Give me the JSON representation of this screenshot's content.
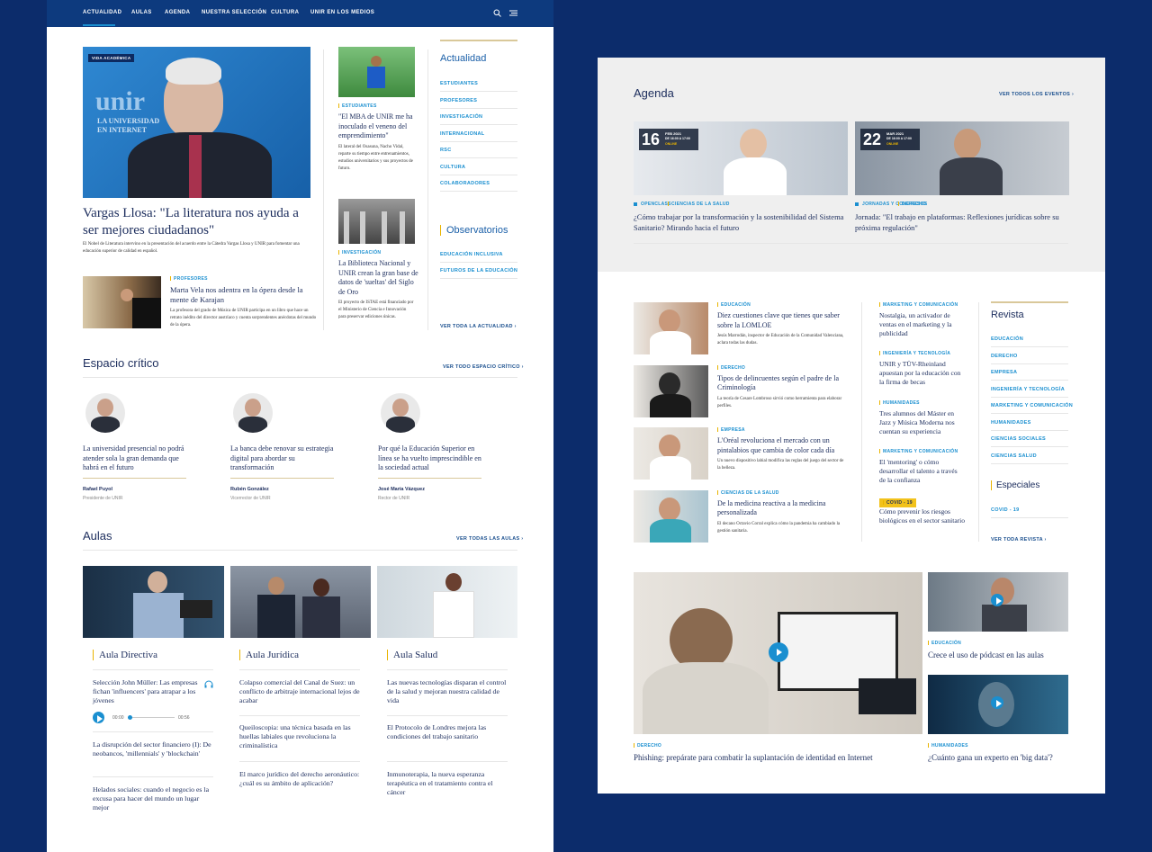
{
  "nav": {
    "items": [
      "ACTUALIDAD",
      "AULAS",
      "AGENDA",
      "NUESTRA SELECCIÓN",
      "CULTURA",
      "UNIR EN LOS MEDIOS"
    ]
  },
  "hero": {
    "badge": "VIDA ACADÉMICA",
    "img_text1": "unir",
    "img_text2": "LA UNIVERSIDAD",
    "img_text3": "EN INTERNET",
    "title": "Vargas Llosa: \"La literatura nos ayuda a ser mejores ciudadanos\"",
    "summary": "El Nobel de Literatura intervino en la presentación del acuerdo entre la Cátedra Vargas Llosa y UNIR para fomentar una educación superior de calidad en español."
  },
  "small_story": {
    "kicker": "PROFESORES",
    "title": "Marta Vela nos adentra en la ópera desde la mente de Karajan",
    "summary": "La profesora del grado de Música de UNIR participa en un libro que hace un retrato inédito del director austríaco y cuenta sorprendentes anécdotas del mundo de la ópera."
  },
  "mid_stories": [
    {
      "kicker": "ESTUDIANTES",
      "title": "\"El MBA de UNIR me ha inoculado el veneno del emprendimiento\"",
      "summary": "El lateral del Osasuna, Nacho Vidal, reparte su tiempo entre entrenamientos, estudios universitarios y sus proyectos de futuro."
    },
    {
      "kicker": "INVESTIGACIÓN",
      "title": "La Biblioteca Nacional y UNIR crean la gran base de datos de 'sueltas' del Siglo de Oro",
      "summary": "El proyecto de ISTAE está financiado por el Ministerio de Ciencia e Innovación para preservar ediciones únicas."
    }
  ],
  "actualidad": {
    "title": "Actualidad",
    "items": [
      "ESTUDIANTES",
      "PROFESORES",
      "INVESTIGACIÓN",
      "INTERNACIONAL",
      "RSC",
      "CULTURA",
      "COLABORADORES"
    ],
    "obs_title": "Observatorios",
    "obs_items": [
      "EDUCACIÓN INCLUSIVA",
      "FUTUROS DE LA EDUCACIÓN"
    ],
    "more": "VER TODA LA ACTUALIDAD ›"
  },
  "espacio": {
    "title": "Espacio crítico",
    "more": "VER TODO ESPACIO CRÍTICO ›",
    "items": [
      {
        "quote": "La universidad presencial no podrá atender sola la gran demanda que habrá en el futuro",
        "name": "Rafael Puyol",
        "role": "Presidente de UNIR"
      },
      {
        "quote": "La banca debe renovar su estrategia digital para abordar su transformación",
        "name": "Rubén González",
        "role": "Vicerrector de UNIR"
      },
      {
        "quote": "Por qué la Educación Superior en línea se ha vuelto imprescindible en la sociedad actual",
        "name": "José María Vázquez",
        "role": "Rector de UNIR"
      }
    ]
  },
  "aulas": {
    "title": "Aulas",
    "more": "VER TODAS LAS AULAS ›",
    "cols": [
      {
        "title": "Aula Directiva",
        "items": [
          "Selección John Müller: Las empresas fichan 'influencers' para atrapar a los jóvenes",
          "La disrupción del sector financiero (I): De neobancos, 'millennials' y 'blockchain'",
          "Helados sociales: cuando el negocio es la excusa para hacer del mundo un lugar mejor"
        ],
        "audio_start": "00:00",
        "audio_end": "00:56"
      },
      {
        "title": "Aula Jurídica",
        "items": [
          "Colapso comercial del Canal de Suez: un conflicto de arbitraje internacional lejos de acabar",
          "Queiloscopia: una técnica basada en las huellas labiales que revoluciona la criminalística",
          "El marco jurídico del derecho aeronáutico: ¿cuál es su ámbito de aplicación?"
        ]
      },
      {
        "title": "Aula Salud",
        "items": [
          "Las nuevas tecnologías disparan el control de la salud y mejoran nuestra calidad de vida",
          "El Protocolo de Londres mejora las condiciones del trabajo sanitario",
          "Inmunoterapia, la nueva esperanza terapéutica en el tratamiento contra el cáncer"
        ]
      }
    ]
  },
  "agenda": {
    "title": "Agenda",
    "more": "VER TODOS LOS EVENTOS ›",
    "events": [
      {
        "day": "16",
        "month": "FEB 2021",
        "time": "DE 16:00 A 17:00",
        "mode": "ONLINE",
        "tag1": "OPENCLASS",
        "tag2": "CIENCIAS DE LA SALUD",
        "title": "¿Cómo trabajar por la transformación y la sostenibilidad del Sistema Sanitario? Mirando hacia el futuro"
      },
      {
        "day": "22",
        "month": "MAR 2021",
        "time": "DE 16:00 A 17:00",
        "mode": "ONLINE",
        "tag1": "JORNADAS Y CONGRESOS",
        "tag2": "DERECHO",
        "title": "Jornada: \"El trabajo en plataformas: Reflexiones jurídicas sobre su próxima regulación\""
      }
    ]
  },
  "list_stories": [
    {
      "kicker": "EDUCACIÓN",
      "title": "Diez cuestiones clave que tienes que saber sobre la LOMLOE",
      "summary": "Jesús Marrodán, inspector de Educación de la Comunidad Valenciana, aclara todas las dudas."
    },
    {
      "kicker": "DERECHO",
      "title": "Tipos de delincuentes según el padre de la Criminología",
      "summary": "La teoría de Cesare Lombroso sirvió como herramienta para elaborar perfiles."
    },
    {
      "kicker": "EMPRESA",
      "title": "L'Oréal revoluciona el mercado con un pintalabios que cambia de color cada día",
      "summary": "Un nuevo dispositivo labial modifica las reglas del juego del sector de la belleza."
    },
    {
      "kicker": "CIENCIAS DE LA SALUD",
      "title": "De la medicina reactiva a la medicina personalizada",
      "summary": "El decano Octavio Corral explica cómo la pandemia ha cambiado la gestión sanitaria."
    }
  ],
  "side_stories": [
    {
      "kicker": "MARKETING Y COMUNICACIÓN",
      "title": "Nostalgia, un activador de ventas en el marketing y la publicidad"
    },
    {
      "kicker": "INGENIERÍA Y TECNOLOGÍA",
      "title": "UNIR y TÜV-Rheinland apuestan por la educación con la firma de becas"
    },
    {
      "kicker": "HUMANIDADES",
      "title": "Tres alumnos del Máster en Jazz y Música Moderna nos cuentan su experiencia"
    },
    {
      "kicker": "MARKETING Y COMUNICACIÓN",
      "title": "El 'mentoring' o cómo desarrollar el talento a través de la confianza"
    },
    {
      "kicker": "COVID - 19",
      "title": "Cómo prevenir los riesgos biológicos en el sector sanitario"
    }
  ],
  "revista": {
    "title": "Revista",
    "items": [
      "EDUCACIÓN",
      "DERECHO",
      "EMPRESA",
      "INGENIERÍA Y TECNOLOGÍA",
      "MARKETING Y COMUNICACIÓN",
      "HUMANIDADES",
      "CIENCIAS SOCIALES",
      "CIENCIAS SALUD"
    ],
    "esp_title": "Especiales",
    "esp_items": [
      "COVID - 19"
    ],
    "more": "VER TODA REVISTA ›"
  },
  "media": {
    "main_kicker": "DERECHO",
    "main_title": "Phishing: prepárate para combatir la suplantación de identidad en Internet",
    "s1_kicker": "EDUCACIÓN",
    "s1_title": "Crece el uso de pódcast en las aulas",
    "s2_kicker": "HUMANIDADES",
    "s2_title": "¿Cuánto gana un experto en 'big data'?"
  },
  "colors": {
    "navy": "#0c2c6b",
    "accent": "#1a8fd0",
    "gold": "#e9b400",
    "heading": "#1b2c5c"
  }
}
